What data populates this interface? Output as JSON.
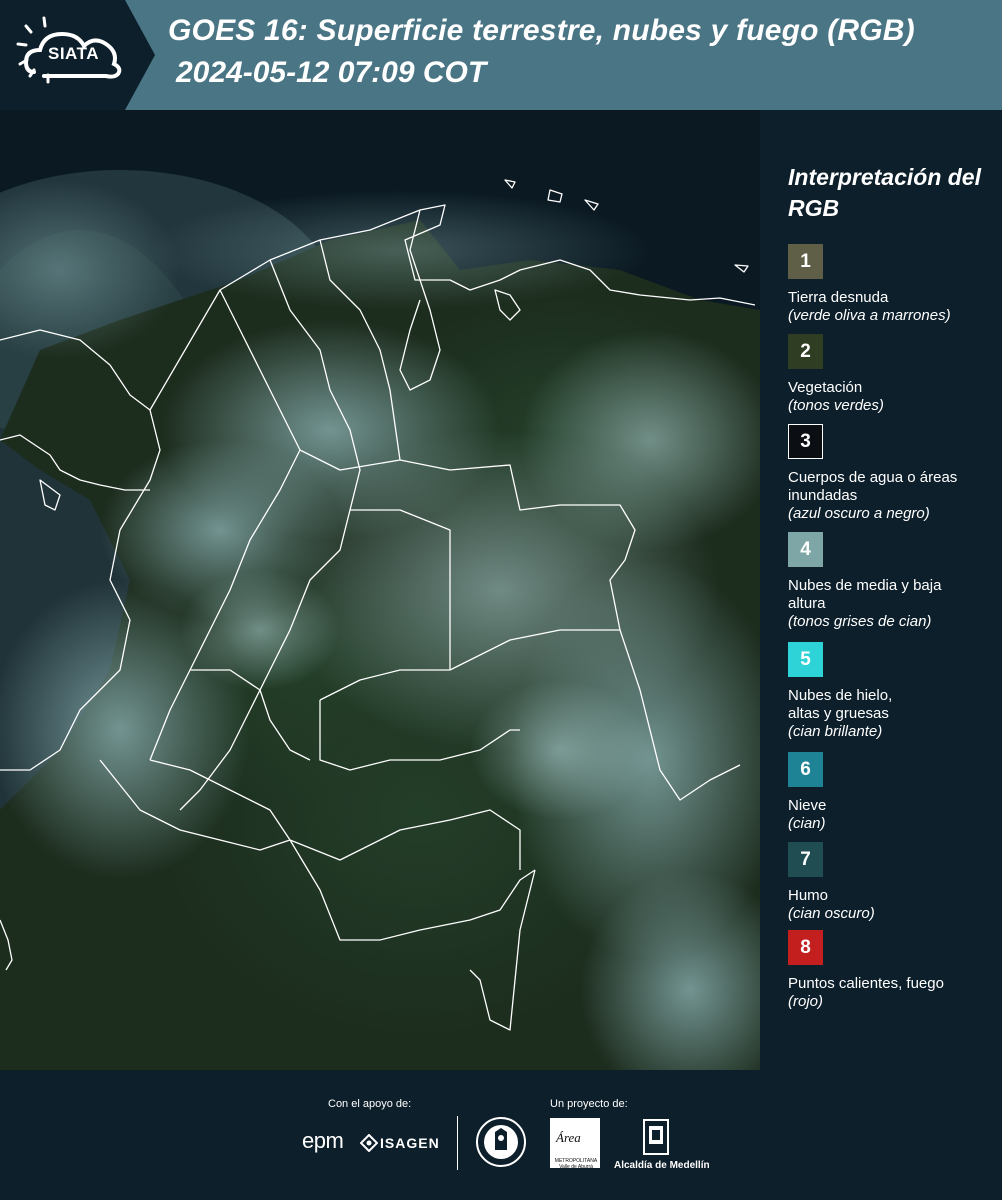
{
  "header": {
    "logo_text": "SIATA",
    "title_line1": "GOES 16: Superficie terrestre, nubes y fuego (RGB)",
    "title_line2": "2024-05-12 07:09 COT",
    "bg_color": "#4a7585",
    "logo_bg_color": "#0d1f2b"
  },
  "legend": {
    "title": "Interpretación del RGB",
    "items": [
      {
        "num": "1",
        "label": "Tierra desnuda",
        "sub": "(verde oliva a marrones)",
        "color": "#5f5f47"
      },
      {
        "num": "2",
        "label": "Vegetación",
        "sub": "(tonos verdes)",
        "color": "#2f3e22"
      },
      {
        "num": "3",
        "label": "Cuerpos de agua o áreas inundadas",
        "sub": "(azul oscuro a negro)",
        "color": "#0b0e12"
      },
      {
        "num": "4",
        "label": "Nubes de media y baja altura",
        "sub": "(tonos grises de cian)",
        "color": "#7fa6a6"
      },
      {
        "num": "5",
        "label": "Nubes de hielo, altas y gruesas",
        "sub": "(cian brillante)",
        "color": "#2ed3d8"
      },
      {
        "num": "6",
        "label": "Nieve",
        "sub": "(cian)",
        "color": "#1f8396"
      },
      {
        "num": "7",
        "label": "Humo",
        "sub": "(cian oscuro)",
        "color": "#1f4d52"
      },
      {
        "num": "8",
        "label": "Puntos calientes, fuego",
        "sub": "(rojo)",
        "color": "#c41f1f"
      }
    ]
  },
  "footer": {
    "support_label": "Con el apoyo de:",
    "project_label": "Un proyecto de:",
    "epm": "epm",
    "isagen": "ISAGEN",
    "area_name": "Área",
    "area_sub": "METROPOLITANA Valle de Aburrá",
    "alcaldia": "Alcaldía de Medellín"
  },
  "map": {
    "bg_color": "#0b1a22",
    "land_color": "#1a2a1c",
    "cloud_color": "#6f9a9f",
    "border_color": "#ffffff"
  }
}
